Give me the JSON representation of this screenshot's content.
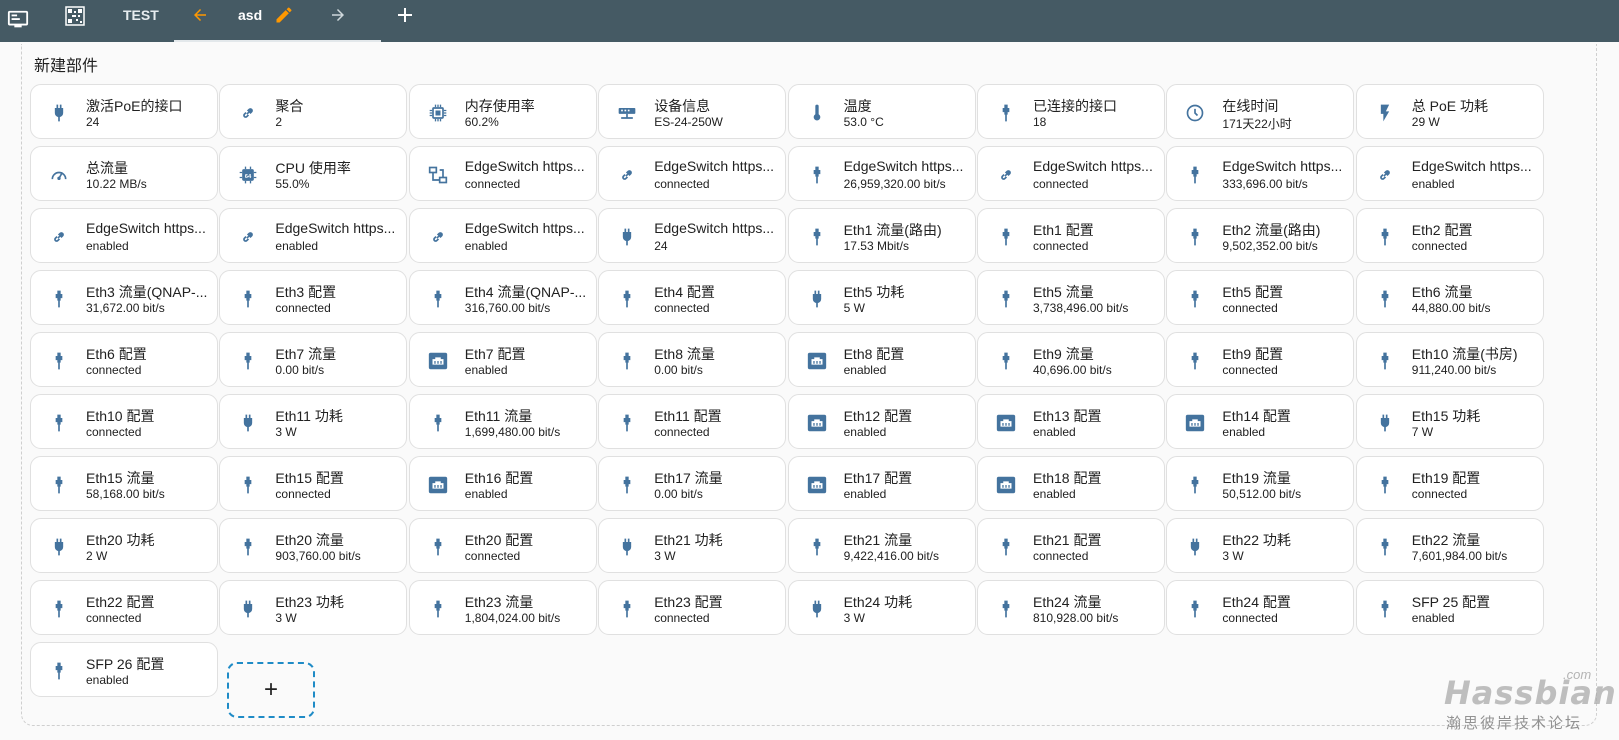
{
  "toolbar": {
    "test_label": "TEST",
    "active_tab": "asd",
    "icons": [
      "monitor-icon",
      "qrcode-icon",
      "arrow-left-icon",
      "pencil-icon",
      "arrow-right-icon",
      "plus-icon"
    ]
  },
  "section": {
    "title": "新建部件"
  },
  "colors": {
    "topbar": "#455a64",
    "icon": "#44739e",
    "accent": "#ff9800",
    "add_border": "#1f8bc6"
  },
  "cards": [
    {
      "name": "激活PoE的接口",
      "state": "24",
      "icon": "plug"
    },
    {
      "name": "聚合",
      "state": "2",
      "icon": "link"
    },
    {
      "name": "内存使用率",
      "state": "60.2%",
      "icon": "chip"
    },
    {
      "name": "设备信息",
      "state": "ES-24-250W",
      "icon": "switch"
    },
    {
      "name": "温度",
      "state": "53.0 °C",
      "icon": "thermometer"
    },
    {
      "name": "已连接的接口",
      "state": "18",
      "icon": "port"
    },
    {
      "name": "在线时间",
      "state": "171天22小时",
      "icon": "clock"
    },
    {
      "name": "总 PoE 功耗",
      "state": "29 W",
      "icon": "flash"
    },
    {
      "name": "总流量",
      "state": "10.22 MB/s",
      "icon": "gauge"
    },
    {
      "name": "CPU 使用率",
      "state": "55.0%",
      "icon": "cpu"
    },
    {
      "name": "EdgeSwitch https...",
      "state": "connected",
      "icon": "lan"
    },
    {
      "name": "EdgeSwitch https...",
      "state": "connected",
      "icon": "link"
    },
    {
      "name": "EdgeSwitch https...",
      "state": "26,959,320.00 bit/s",
      "icon": "port"
    },
    {
      "name": "EdgeSwitch https...",
      "state": "connected",
      "icon": "link"
    },
    {
      "name": "EdgeSwitch https...",
      "state": "333,696.00 bit/s",
      "icon": "port"
    },
    {
      "name": "EdgeSwitch https...",
      "state": "enabled",
      "icon": "link"
    },
    {
      "name": "EdgeSwitch https...",
      "state": "enabled",
      "icon": "link"
    },
    {
      "name": "EdgeSwitch https...",
      "state": "enabled",
      "icon": "link"
    },
    {
      "name": "EdgeSwitch https...",
      "state": "enabled",
      "icon": "link"
    },
    {
      "name": "EdgeSwitch https...",
      "state": "24",
      "icon": "plug"
    },
    {
      "name": "Eth1 流量(路由)",
      "state": "17.53 Mbit/s",
      "icon": "port"
    },
    {
      "name": "Eth1 配置",
      "state": "connected",
      "icon": "port"
    },
    {
      "name": "Eth2 流量(路由)",
      "state": "9,502,352.00 bit/s",
      "icon": "port"
    },
    {
      "name": "Eth2 配置",
      "state": "connected",
      "icon": "port"
    },
    {
      "name": "Eth3 流量(QNAP-...",
      "state": "31,672.00 bit/s",
      "icon": "port"
    },
    {
      "name": "Eth3 配置",
      "state": "connected",
      "icon": "port"
    },
    {
      "name": "Eth4 流量(QNAP-...",
      "state": "316,760.00 bit/s",
      "icon": "port"
    },
    {
      "name": "Eth4 配置",
      "state": "connected",
      "icon": "port"
    },
    {
      "name": "Eth5 功耗",
      "state": "5 W",
      "icon": "plug"
    },
    {
      "name": "Eth5 流量",
      "state": "3,738,496.00 bit/s",
      "icon": "port"
    },
    {
      "name": "Eth5 配置",
      "state": "connected",
      "icon": "port"
    },
    {
      "name": "Eth6 流量",
      "state": "44,880.00 bit/s",
      "icon": "port"
    },
    {
      "name": "Eth6 配置",
      "state": "connected",
      "icon": "port"
    },
    {
      "name": "Eth7 流量",
      "state": "0.00 bit/s",
      "icon": "port"
    },
    {
      "name": "Eth7 配置",
      "state": "enabled",
      "icon": "ethernet"
    },
    {
      "name": "Eth8 流量",
      "state": "0.00 bit/s",
      "icon": "port"
    },
    {
      "name": "Eth8 配置",
      "state": "enabled",
      "icon": "ethernet"
    },
    {
      "name": "Eth9 流量",
      "state": "40,696.00 bit/s",
      "icon": "port"
    },
    {
      "name": "Eth9 配置",
      "state": "connected",
      "icon": "port"
    },
    {
      "name": "Eth10 流量(书房)",
      "state": "911,240.00 bit/s",
      "icon": "port"
    },
    {
      "name": "Eth10 配置",
      "state": "connected",
      "icon": "port"
    },
    {
      "name": "Eth11 功耗",
      "state": "3 W",
      "icon": "plug"
    },
    {
      "name": "Eth11 流量",
      "state": "1,699,480.00 bit/s",
      "icon": "port"
    },
    {
      "name": "Eth11 配置",
      "state": "connected",
      "icon": "port"
    },
    {
      "name": "Eth12 配置",
      "state": "enabled",
      "icon": "ethernet"
    },
    {
      "name": "Eth13 配置",
      "state": "enabled",
      "icon": "ethernet"
    },
    {
      "name": "Eth14 配置",
      "state": "enabled",
      "icon": "ethernet"
    },
    {
      "name": "Eth15 功耗",
      "state": "7 W",
      "icon": "plug"
    },
    {
      "name": "Eth15 流量",
      "state": "58,168.00 bit/s",
      "icon": "port"
    },
    {
      "name": "Eth15 配置",
      "state": "connected",
      "icon": "port"
    },
    {
      "name": "Eth16 配置",
      "state": "enabled",
      "icon": "ethernet"
    },
    {
      "name": "Eth17 流量",
      "state": "0.00 bit/s",
      "icon": "port"
    },
    {
      "name": "Eth17 配置",
      "state": "enabled",
      "icon": "ethernet"
    },
    {
      "name": "Eth18 配置",
      "state": "enabled",
      "icon": "ethernet"
    },
    {
      "name": "Eth19 流量",
      "state": "50,512.00 bit/s",
      "icon": "port"
    },
    {
      "name": "Eth19 配置",
      "state": "connected",
      "icon": "port"
    },
    {
      "name": "Eth20 功耗",
      "state": "2 W",
      "icon": "plug"
    },
    {
      "name": "Eth20 流量",
      "state": "903,760.00 bit/s",
      "icon": "port"
    },
    {
      "name": "Eth20 配置",
      "state": "connected",
      "icon": "port"
    },
    {
      "name": "Eth21 功耗",
      "state": "3 W",
      "icon": "plug"
    },
    {
      "name": "Eth21 流量",
      "state": "9,422,416.00 bit/s",
      "icon": "port"
    },
    {
      "name": "Eth21 配置",
      "state": "connected",
      "icon": "port"
    },
    {
      "name": "Eth22 功耗",
      "state": "3 W",
      "icon": "plug"
    },
    {
      "name": "Eth22 流量",
      "state": "7,601,984.00 bit/s",
      "icon": "port"
    },
    {
      "name": "Eth22 配置",
      "state": "connected",
      "icon": "port"
    },
    {
      "name": "Eth23 功耗",
      "state": "3 W",
      "icon": "plug"
    },
    {
      "name": "Eth23 流量",
      "state": "1,804,024.00 bit/s",
      "icon": "port"
    },
    {
      "name": "Eth23 配置",
      "state": "connected",
      "icon": "port"
    },
    {
      "name": "Eth24 功耗",
      "state": "3 W",
      "icon": "plug"
    },
    {
      "name": "Eth24 流量",
      "state": "810,928.00 bit/s",
      "icon": "port"
    },
    {
      "name": "Eth24 配置",
      "state": "connected",
      "icon": "port"
    },
    {
      "name": "SFP 25 配置",
      "state": "enabled",
      "icon": "port"
    },
    {
      "name": "SFP 26 配置",
      "state": "enabled",
      "icon": "port"
    }
  ],
  "add_card": {
    "icon": "plus-icon",
    "symbol": "+"
  },
  "watermark": {
    "brand": "Hassbian",
    "domain": ".com",
    "tagline": "瀚思彼岸技术论坛"
  }
}
